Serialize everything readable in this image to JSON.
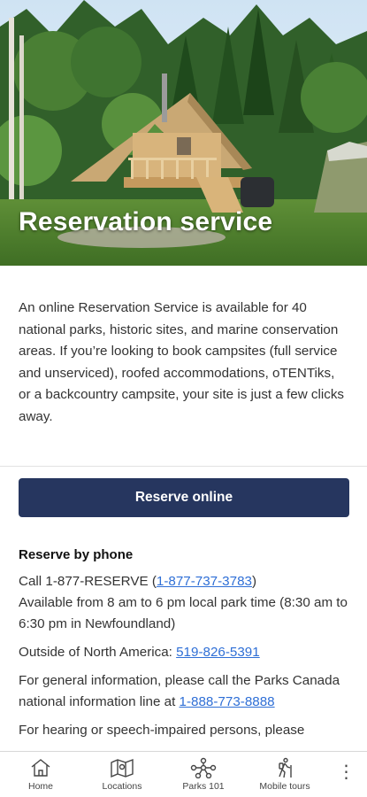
{
  "hero": {
    "title": "Reservation service",
    "image": "otentik-cabin-in-forest-photo"
  },
  "intro": {
    "text": "An online Reservation Service is available for 40 national parks, historic sites, and marine conservation areas. If you’re looking to book campsites (full service and unserviced), roofed accommodations, oTENTiks, or a backcountry campsite, your site is just a few clicks away."
  },
  "reserve_button": {
    "label": "Reserve online"
  },
  "phone": {
    "heading": "Reserve by phone",
    "call_prefix": "Call 1-877-RESERVE (",
    "call_number": "1-877-737-3783",
    "call_suffix": ")",
    "hours": "Available from 8 am to 6 pm local park time (8:30 am to 6:30 pm in Newfoundland)",
    "outside_prefix": "Outside of North America: ",
    "outside_number": "519-826-5391",
    "general_prefix": "For general information, please call the Parks Canada national information line at ",
    "general_number": "1-888-773-8888",
    "partial_text": "For hearing or speech-impaired persons, please"
  },
  "nav": {
    "items": [
      {
        "label": "Home",
        "icon": "home-icon"
      },
      {
        "label": "Locations",
        "icon": "map-icon"
      },
      {
        "label": "Parks 101",
        "icon": "network-icon"
      },
      {
        "label": "Mobile tours",
        "icon": "hiker-icon"
      }
    ],
    "more_icon": "more-vertical-icon"
  },
  "colors": {
    "button_bg": "#26365f",
    "link": "#2f6fd6"
  }
}
